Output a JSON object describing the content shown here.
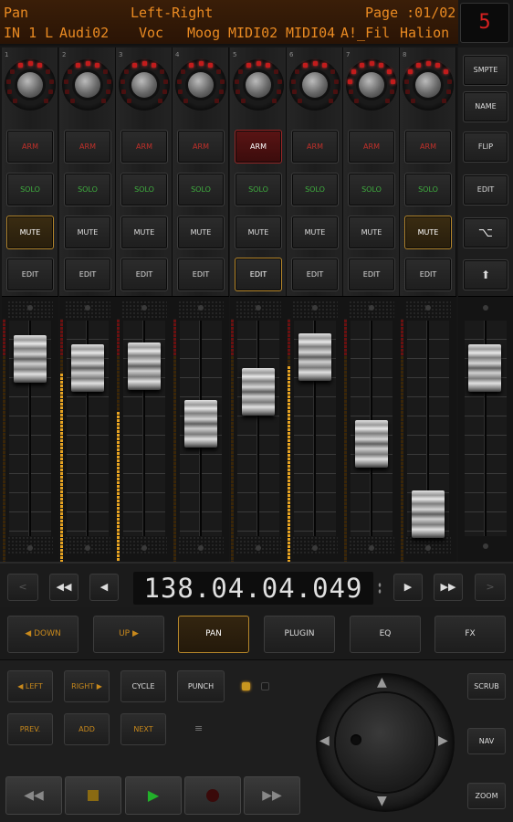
{
  "lcd": {
    "mode": "Pan",
    "param": "Left-Right",
    "page": "Page :01/02",
    "tracks": [
      "IN 1 L",
      "Audi02",
      "Voc",
      "Moog",
      "MIDI02",
      "MIDI04",
      "A!_Fil",
      "Halion"
    ]
  },
  "bank_number": "5",
  "channels": [
    {
      "num": "1",
      "knob_leds": 3,
      "arm": false,
      "mute": true,
      "edit": false,
      "fader_level": 0.82,
      "meter_level": 0.0
    },
    {
      "num": "2",
      "knob_leds": 3,
      "arm": false,
      "mute": false,
      "edit": false,
      "fader_level": 0.78,
      "meter_level": 0.78
    },
    {
      "num": "3",
      "knob_leds": 2,
      "arm": false,
      "mute": false,
      "edit": false,
      "fader_level": 0.79,
      "meter_level": 0.62
    },
    {
      "num": "4",
      "knob_leds": 2,
      "arm": false,
      "mute": false,
      "edit": false,
      "fader_level": 0.52,
      "meter_level": 0.0
    },
    {
      "num": "5",
      "knob_leds": 2,
      "arm": true,
      "mute": false,
      "edit": true,
      "fader_level": 0.67,
      "meter_level": 0.0
    },
    {
      "num": "6",
      "knob_leds": 2,
      "arm": false,
      "mute": false,
      "edit": false,
      "fader_level": 0.83,
      "meter_level": 0.81
    },
    {
      "num": "7",
      "knob_leds": 6,
      "arm": false,
      "mute": false,
      "edit": false,
      "fader_level": 0.43,
      "meter_level": 0.0
    },
    {
      "num": "8",
      "knob_leds": 4,
      "arm": false,
      "mute": true,
      "edit": false,
      "fader_level": 0.1,
      "meter_level": 0.0
    }
  ],
  "strip_labels": {
    "arm": "ARM",
    "solo": "SOLO",
    "mute": "MUTE",
    "edit": "EDIT"
  },
  "side_buttons": [
    "SMPTE",
    "NAME",
    "FLIP",
    "EDIT",
    "⌥",
    "⬆"
  ],
  "master_fader_level": 0.78,
  "transport": {
    "timecode": "138.04.04.049",
    "icons": [
      "chevron-left-icon",
      "rewind-icon",
      "step-back-icon",
      "step-forward-icon",
      "fast-forward-icon",
      "chevron-right-icon"
    ]
  },
  "nav_row": [
    {
      "label": "◀ DOWN",
      "style": "orange"
    },
    {
      "label": "UP ▶",
      "style": "orange"
    },
    {
      "label": "PAN",
      "style": "on"
    },
    {
      "label": "PLUGIN",
      "style": ""
    },
    {
      "label": "EQ",
      "style": ""
    },
    {
      "label": "FX",
      "style": ""
    }
  ],
  "bottom": {
    "row1": [
      "◀ LEFT",
      "RIGHT ▶",
      "CYCLE",
      "PUNCH"
    ],
    "row2": [
      "PREV.",
      "ADD",
      "NEXT"
    ],
    "right_buttons": [
      "SCRUB",
      "NAV",
      "ZOOM"
    ],
    "led_colors": [
      "#c9961f",
      "#2a2a2a"
    ]
  },
  "colors": {
    "accent": "#e98a22",
    "arm": "#c0302a",
    "solo": "#3fae3f",
    "meter": "#e7a321",
    "play": "#22b02a",
    "record": "#3a0a0a"
  }
}
